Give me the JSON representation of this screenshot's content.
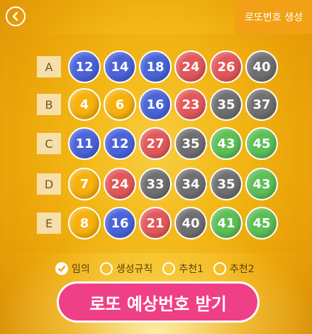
{
  "header": {
    "title": "로또번호 생성",
    "back_icon": "back-arrow-icon"
  },
  "rows": [
    {
      "label": "A",
      "balls": [
        {
          "num": "12",
          "color": "#4a63d8"
        },
        {
          "num": "14",
          "color": "#4a63d8"
        },
        {
          "num": "18",
          "color": "#4a63d8"
        },
        {
          "num": "24",
          "color": "#e2585a"
        },
        {
          "num": "26",
          "color": "#e2585a"
        },
        {
          "num": "40",
          "color": "#6f6f6f"
        }
      ]
    },
    {
      "label": "B",
      "balls": [
        {
          "num": "4",
          "color": "#f7b10c"
        },
        {
          "num": "6",
          "color": "#f7b10c"
        },
        {
          "num": "16",
          "color": "#4a63d8"
        },
        {
          "num": "23",
          "color": "#e2585a"
        },
        {
          "num": "35",
          "color": "#6f6f6f"
        },
        {
          "num": "37",
          "color": "#6f6f6f"
        }
      ]
    },
    {
      "label": "C",
      "balls": [
        {
          "num": "11",
          "color": "#4a63d8"
        },
        {
          "num": "12",
          "color": "#4a63d8"
        },
        {
          "num": "27",
          "color": "#e2585a"
        },
        {
          "num": "35",
          "color": "#6f6f6f"
        },
        {
          "num": "43",
          "color": "#5cbf55"
        },
        {
          "num": "45",
          "color": "#5cbf55"
        }
      ]
    },
    {
      "label": "D",
      "balls": [
        {
          "num": "7",
          "color": "#f7b10c"
        },
        {
          "num": "24",
          "color": "#e2585a"
        },
        {
          "num": "33",
          "color": "#6f6f6f"
        },
        {
          "num": "34",
          "color": "#6f6f6f"
        },
        {
          "num": "35",
          "color": "#6f6f6f"
        },
        {
          "num": "43",
          "color": "#5cbf55"
        }
      ]
    },
    {
      "label": "E",
      "balls": [
        {
          "num": "8",
          "color": "#f7b10c"
        },
        {
          "num": "16",
          "color": "#4a63d8"
        },
        {
          "num": "21",
          "color": "#e2585a"
        },
        {
          "num": "40",
          "color": "#6f6f6f"
        },
        {
          "num": "41",
          "color": "#5cbf55"
        },
        {
          "num": "45",
          "color": "#5cbf55"
        }
      ]
    }
  ],
  "options": [
    {
      "label": "임의",
      "checked": true
    },
    {
      "label": "생성규칙",
      "checked": false
    },
    {
      "label": "추천1",
      "checked": false
    },
    {
      "label": "추천2",
      "checked": false
    }
  ],
  "action_button": {
    "label": "로또 예상번호 받기",
    "color": "#ef3f86"
  },
  "ball_colors": {
    "1-10": "#f7b10c",
    "11-20": "#4a63d8",
    "21-30": "#e2585a",
    "31-40": "#6f6f6f",
    "41-45": "#5cbf55"
  }
}
